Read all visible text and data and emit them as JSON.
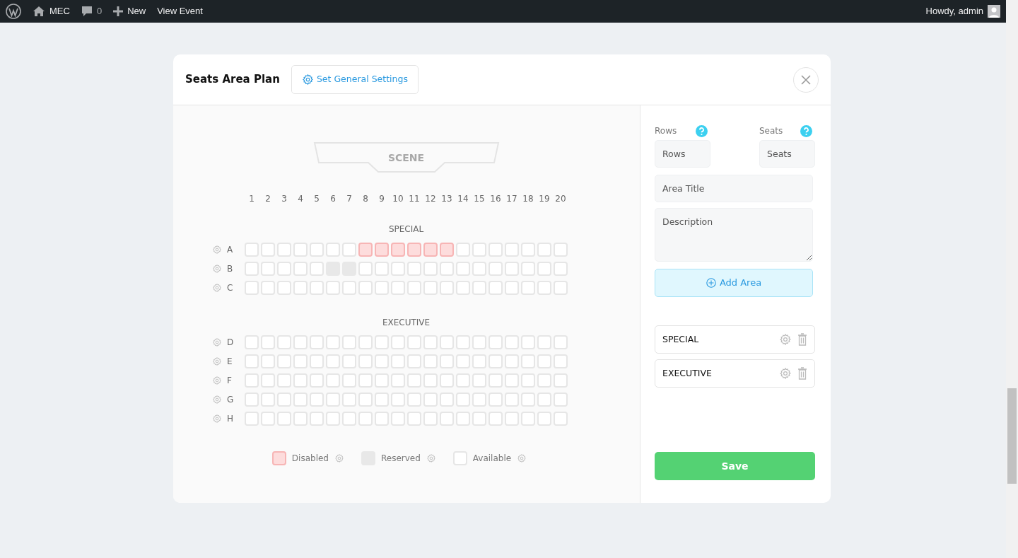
{
  "admin_bar": {
    "site": "MEC",
    "comments": "0",
    "new": "New",
    "view": "View Event",
    "greeting": "Howdy, admin"
  },
  "modal": {
    "title": "Seats Area Plan",
    "settings_button": "Set General Settings"
  },
  "scene": "SCENE",
  "columns": [
    "1",
    "2",
    "3",
    "4",
    "5",
    "6",
    "7",
    "8",
    "9",
    "10",
    "11",
    "12",
    "13",
    "14",
    "15",
    "16",
    "17",
    "18",
    "19",
    "20"
  ],
  "areas": [
    {
      "title": "SPECIAL",
      "rows": [
        {
          "label": "A",
          "seats": [
            {
              "kind": "available"
            },
            {
              "kind": "available"
            },
            {
              "kind": "available"
            },
            {
              "kind": "available"
            },
            {
              "kind": "available"
            },
            {
              "kind": "available"
            },
            {
              "kind": "available"
            },
            {
              "kind": "disabled"
            },
            {
              "kind": "disabled"
            },
            {
              "kind": "disabled"
            },
            {
              "kind": "disabled"
            },
            {
              "kind": "disabled"
            },
            {
              "kind": "disabled"
            },
            {
              "kind": "available"
            },
            {
              "kind": "available"
            },
            {
              "kind": "available"
            },
            {
              "kind": "available"
            },
            {
              "kind": "available"
            },
            {
              "kind": "available"
            },
            {
              "kind": "available"
            }
          ]
        },
        {
          "label": "B",
          "seats": [
            {
              "kind": "available"
            },
            {
              "kind": "available"
            },
            {
              "kind": "available"
            },
            {
              "kind": "available"
            },
            {
              "kind": "available"
            },
            {
              "kind": "reserved"
            },
            {
              "kind": "reserved"
            },
            {
              "kind": "available"
            },
            {
              "kind": "available"
            },
            {
              "kind": "available"
            },
            {
              "kind": "available"
            },
            {
              "kind": "available"
            },
            {
              "kind": "available"
            },
            {
              "kind": "available"
            },
            {
              "kind": "available"
            },
            {
              "kind": "available"
            },
            {
              "kind": "available"
            },
            {
              "kind": "available"
            },
            {
              "kind": "available"
            },
            {
              "kind": "available"
            }
          ]
        },
        {
          "label": "C",
          "seats": [
            {
              "kind": "available"
            },
            {
              "kind": "available"
            },
            {
              "kind": "available"
            },
            {
              "kind": "available"
            },
            {
              "kind": "available"
            },
            {
              "kind": "available"
            },
            {
              "kind": "available"
            },
            {
              "kind": "available"
            },
            {
              "kind": "available"
            },
            {
              "kind": "available"
            },
            {
              "kind": "available"
            },
            {
              "kind": "available"
            },
            {
              "kind": "available"
            },
            {
              "kind": "available"
            },
            {
              "kind": "available"
            },
            {
              "kind": "available"
            },
            {
              "kind": "available"
            },
            {
              "kind": "available"
            },
            {
              "kind": "available"
            },
            {
              "kind": "available"
            }
          ]
        }
      ]
    },
    {
      "title": "EXECUTIVE",
      "rows": [
        {
          "label": "D",
          "seats": [
            {
              "kind": "available"
            },
            {
              "kind": "available"
            },
            {
              "kind": "available"
            },
            {
              "kind": "available"
            },
            {
              "kind": "available"
            },
            {
              "kind": "available"
            },
            {
              "kind": "available"
            },
            {
              "kind": "available"
            },
            {
              "kind": "available"
            },
            {
              "kind": "available"
            },
            {
              "kind": "available"
            },
            {
              "kind": "available"
            },
            {
              "kind": "available"
            },
            {
              "kind": "available"
            },
            {
              "kind": "available"
            },
            {
              "kind": "available"
            },
            {
              "kind": "available"
            },
            {
              "kind": "available"
            },
            {
              "kind": "available"
            },
            {
              "kind": "available"
            }
          ]
        },
        {
          "label": "E",
          "seats": [
            {
              "kind": "available"
            },
            {
              "kind": "available"
            },
            {
              "kind": "available"
            },
            {
              "kind": "available"
            },
            {
              "kind": "available"
            },
            {
              "kind": "available"
            },
            {
              "kind": "available"
            },
            {
              "kind": "available"
            },
            {
              "kind": "available"
            },
            {
              "kind": "available"
            },
            {
              "kind": "available"
            },
            {
              "kind": "available"
            },
            {
              "kind": "available"
            },
            {
              "kind": "available"
            },
            {
              "kind": "available"
            },
            {
              "kind": "available"
            },
            {
              "kind": "available"
            },
            {
              "kind": "available"
            },
            {
              "kind": "available"
            },
            {
              "kind": "available"
            }
          ]
        },
        {
          "label": "F",
          "seats": [
            {
              "kind": "available"
            },
            {
              "kind": "available"
            },
            {
              "kind": "available"
            },
            {
              "kind": "available"
            },
            {
              "kind": "available"
            },
            {
              "kind": "available"
            },
            {
              "kind": "available"
            },
            {
              "kind": "available"
            },
            {
              "kind": "available"
            },
            {
              "kind": "available"
            },
            {
              "kind": "available"
            },
            {
              "kind": "available"
            },
            {
              "kind": "available"
            },
            {
              "kind": "available"
            },
            {
              "kind": "available"
            },
            {
              "kind": "available"
            },
            {
              "kind": "available"
            },
            {
              "kind": "available"
            },
            {
              "kind": "available"
            },
            {
              "kind": "available"
            }
          ]
        },
        {
          "label": "G",
          "seats": [
            {
              "kind": "available"
            },
            {
              "kind": "available"
            },
            {
              "kind": "available"
            },
            {
              "kind": "available"
            },
            {
              "kind": "available"
            },
            {
              "kind": "available"
            },
            {
              "kind": "available"
            },
            {
              "kind": "available"
            },
            {
              "kind": "available"
            },
            {
              "kind": "available"
            },
            {
              "kind": "available"
            },
            {
              "kind": "available"
            },
            {
              "kind": "available"
            },
            {
              "kind": "available"
            },
            {
              "kind": "available"
            },
            {
              "kind": "available"
            },
            {
              "kind": "available"
            },
            {
              "kind": "available"
            },
            {
              "kind": "available"
            },
            {
              "kind": "available"
            }
          ]
        },
        {
          "label": "H",
          "seats": [
            {
              "kind": "available"
            },
            {
              "kind": "available"
            },
            {
              "kind": "available"
            },
            {
              "kind": "available"
            },
            {
              "kind": "available"
            },
            {
              "kind": "available"
            },
            {
              "kind": "available"
            },
            {
              "kind": "available"
            },
            {
              "kind": "available"
            },
            {
              "kind": "available"
            },
            {
              "kind": "available"
            },
            {
              "kind": "available"
            },
            {
              "kind": "available"
            },
            {
              "kind": "available"
            },
            {
              "kind": "available"
            },
            {
              "kind": "available"
            },
            {
              "kind": "available"
            },
            {
              "kind": "available"
            },
            {
              "kind": "available"
            },
            {
              "kind": "available"
            }
          ]
        }
      ]
    }
  ],
  "legend": [
    {
      "label": "Disabled",
      "kind": "disabled"
    },
    {
      "label": "Reserved",
      "kind": "reserved"
    },
    {
      "label": "Available",
      "kind": "available"
    }
  ],
  "form": {
    "rows_label": "Rows",
    "rows_placeholder": "Rows",
    "seats_label": "Seats",
    "seats_placeholder": "Seats",
    "title_placeholder": "Area Title",
    "description_placeholder": "Description",
    "add_button": "Add Area"
  },
  "area_list": [
    "SPECIAL",
    "EXECUTIVE"
  ],
  "save": "Save"
}
